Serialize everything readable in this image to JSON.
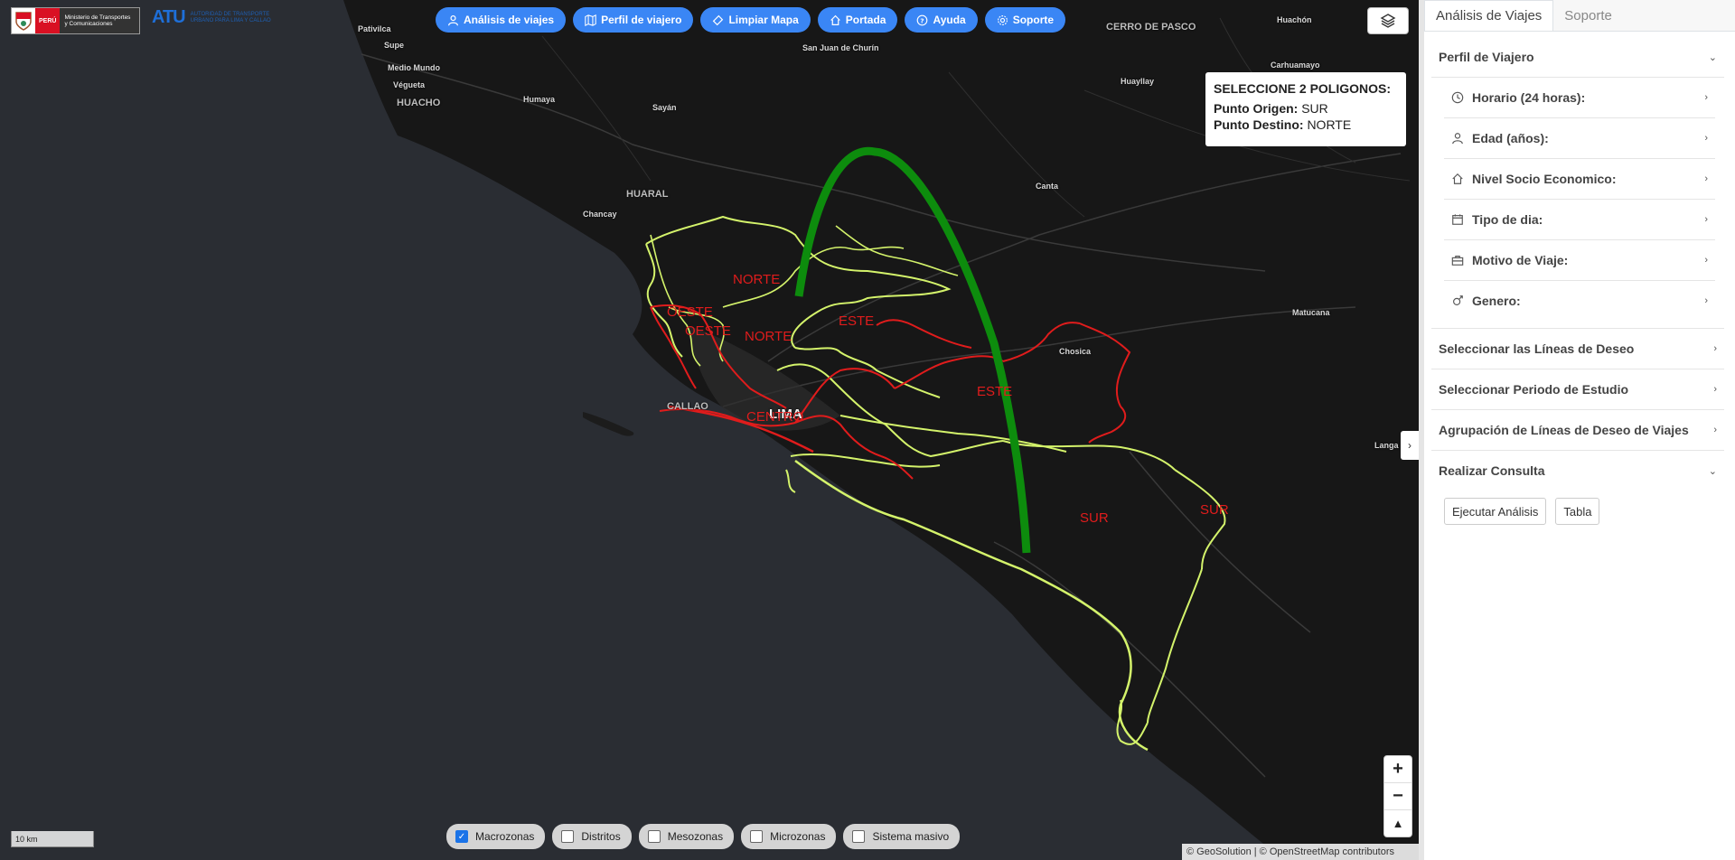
{
  "logos": {
    "peru": "PERÚ",
    "ministry": "Ministerio de Transportes y Comunicaciones",
    "atu_mark": "ATU",
    "atu_text": "AUTORIDAD DE TRANSPORTE URBANO PARA LIMA Y CALLAO"
  },
  "toolbar": [
    {
      "label": "Análisis de viajes",
      "icon": "user-icon"
    },
    {
      "label": "Perfil de viajero",
      "icon": "map-icon"
    },
    {
      "label": "Limpiar Mapa",
      "icon": "eraser-icon"
    },
    {
      "label": "Portada",
      "icon": "home-icon"
    },
    {
      "label": "Ayuda",
      "icon": "help-icon"
    },
    {
      "label": "Soporte",
      "icon": "gear-icon"
    }
  ],
  "info_box": {
    "title": "SELECCIONE 2 POLIGONOS:",
    "origin_label": "Punto Origen:",
    "origin_value": "SUR",
    "dest_label": "Punto Destino:",
    "dest_value": "NORTE"
  },
  "places": {
    "pativilca": "Pativilca",
    "supe": "Supe",
    "medio_mundo": "Medio Mundo",
    "vegueta": "Végueta",
    "huacho": "HUACHO",
    "humaya": "Humaya",
    "sayan": "Sayán",
    "churin": "San Juan de Churín",
    "cerro": "CERRO DE PASCO",
    "huachon": "Huachón",
    "huayllay": "Huayllay",
    "carhuamayo": "Carhuamayo",
    "huaral": "HUARAL",
    "chancay": "Chancay",
    "canta": "Canta",
    "matucana": "Matucana",
    "chosica": "Chosica",
    "callao": "CALLAO",
    "lima": "LIMA",
    "langa": "Langa"
  },
  "zones": {
    "norte1": "NORTE",
    "norte2": "NORTE",
    "oeste1": "OESTE",
    "oeste2": "OESTE",
    "este1": "ESTE",
    "este2": "ESTE",
    "centro": "CENTRO",
    "sur1": "SUR",
    "sur2": "SUR"
  },
  "scale": "10 km",
  "layers_toggle": [
    {
      "label": "Macrozonas",
      "checked": true
    },
    {
      "label": "Distritos",
      "checked": false
    },
    {
      "label": "Mesozonas",
      "checked": false
    },
    {
      "label": "Microzonas",
      "checked": false
    },
    {
      "label": "Sistema masivo",
      "checked": false
    }
  ],
  "attribution": "© GeoSolution | © OpenStreetMap contributors",
  "zoom": {
    "in": "+",
    "out": "−",
    "north": "▲"
  },
  "sidebar": {
    "tabs": [
      "Análisis de Viajes",
      "Soporte"
    ],
    "perfil_title": "Perfil de Viajero",
    "perfil_items": [
      {
        "label": "Horario (24 horas):",
        "icon": "clock-icon"
      },
      {
        "label": "Edad (años):",
        "icon": "person-icon"
      },
      {
        "label": "Nivel Socio Economico:",
        "icon": "home-icon"
      },
      {
        "label": "Tipo de dia:",
        "icon": "calendar-icon"
      },
      {
        "label": "Motivo de Viaje:",
        "icon": "briefcase-icon"
      },
      {
        "label": "Genero:",
        "icon": "gender-icon"
      }
    ],
    "sections": [
      "Seleccionar las Líneas de Deseo",
      "Seleccionar Periodo de Estudio",
      "Agrupación de Líneas de Deseo de Viajes"
    ],
    "consulta_title": "Realizar Consulta",
    "buttons": [
      "Ejecutar Análisis",
      "Tabla"
    ]
  }
}
